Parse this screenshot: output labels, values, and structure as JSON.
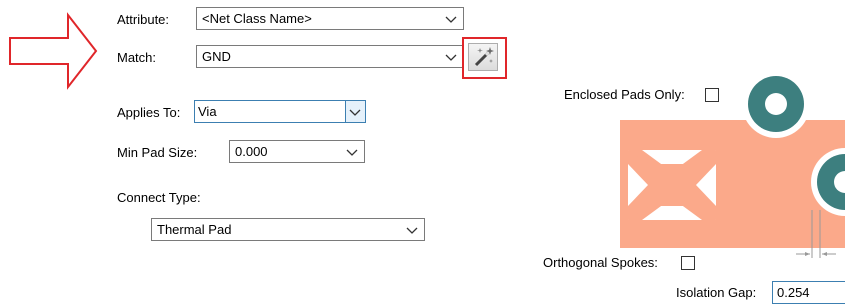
{
  "attribute": {
    "label": "Attribute:",
    "value": "<Net Class Name>"
  },
  "match": {
    "label": "Match:",
    "value": "GND"
  },
  "applies_to": {
    "label": "Applies To:",
    "value": "Via"
  },
  "min_pad_size": {
    "label": "Min Pad Size:",
    "value": "0.000"
  },
  "connect_type": {
    "label": "Connect Type:",
    "value": "Thermal Pad"
  },
  "enclosed_pads_only": {
    "label": "Enclosed Pads Only:",
    "checked": false
  },
  "orthogonal_spokes": {
    "label": "Orthogonal Spokes:",
    "checked": false
  },
  "isolation_gap": {
    "label": "Isolation Gap:",
    "value": "0.254"
  },
  "icons": {
    "wand": "magic-wand-icon",
    "arrow": "arrow-right-icon"
  },
  "colors": {
    "pad_copper": "#fba98a",
    "via_ring": "#3d7f7f",
    "arrow_outline": "#e0262a",
    "highlight_border": "#e0262a",
    "focus_border": "#3c7fb1"
  }
}
